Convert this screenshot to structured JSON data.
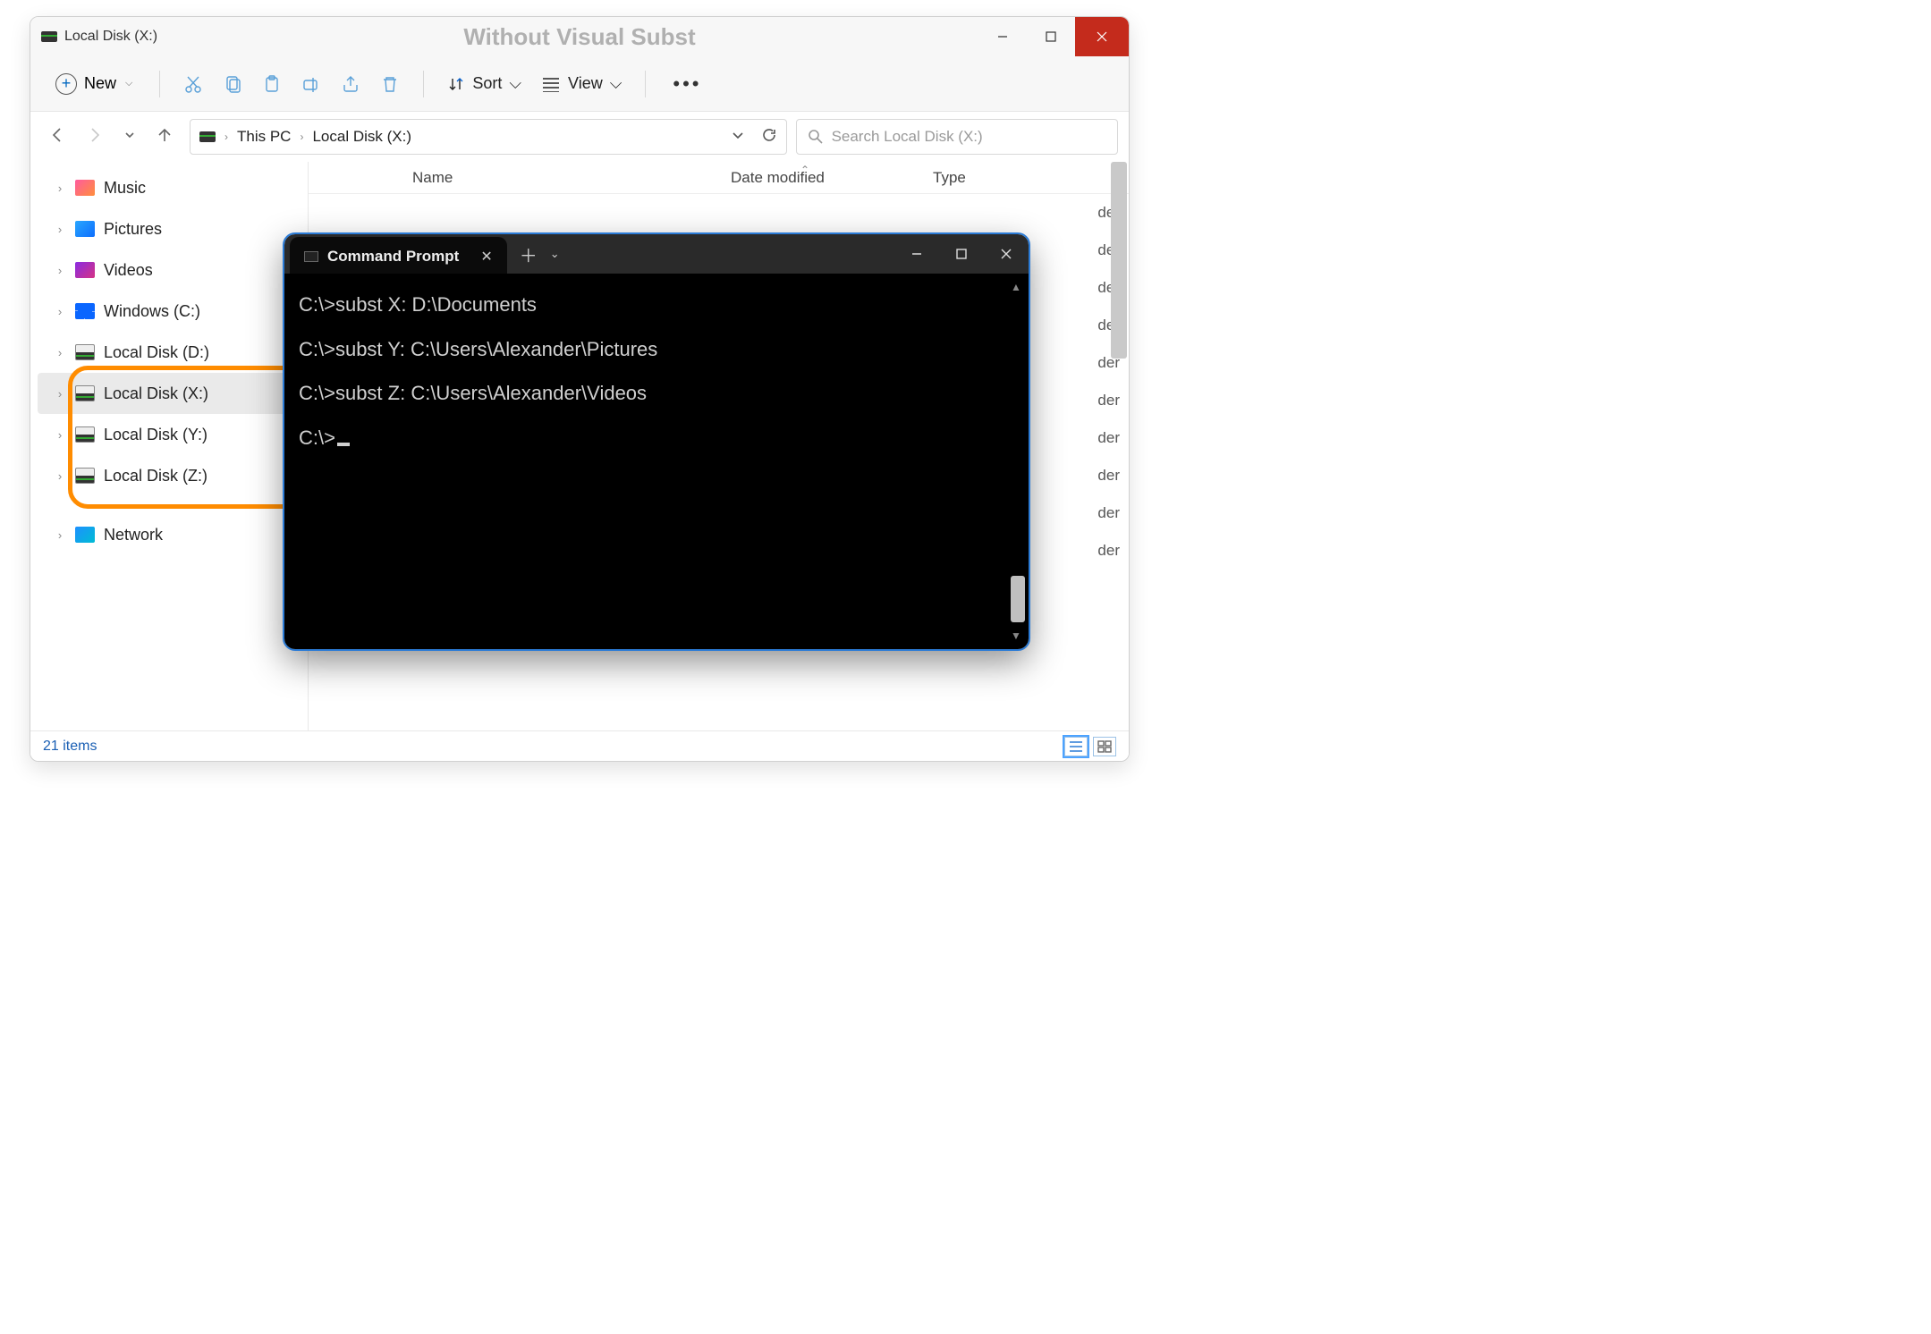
{
  "titlebar": {
    "title": "Local Disk (X:)",
    "center": "Without Visual Subst"
  },
  "toolbar": {
    "new_label": "New",
    "sort_label": "Sort",
    "view_label": "View"
  },
  "breadcrumb": {
    "item1": "This PC",
    "item2": "Local Disk (X:)"
  },
  "search": {
    "placeholder": "Search Local Disk (X:)"
  },
  "sidebar": {
    "items": [
      {
        "label": "Music"
      },
      {
        "label": "Pictures"
      },
      {
        "label": "Videos"
      },
      {
        "label": "Windows (C:)"
      },
      {
        "label": "Local Disk (D:)"
      },
      {
        "label": "Local Disk (X:)"
      },
      {
        "label": "Local Disk (Y:)"
      },
      {
        "label": "Local Disk (Z:)"
      },
      {
        "label": "Network"
      }
    ]
  },
  "columns": {
    "name": "Name",
    "date": "Date modified",
    "type": "Type"
  },
  "row_type_label": "der",
  "status": {
    "count": "21 items"
  },
  "cmd": {
    "title": "Command Prompt",
    "lines": [
      "C:\\>subst X: D:\\Documents",
      "C:\\>subst Y: C:\\Users\\Alexander\\Pictures",
      "C:\\>subst Z: C:\\Users\\Alexander\\Videos"
    ],
    "prompt": "C:\\>"
  }
}
